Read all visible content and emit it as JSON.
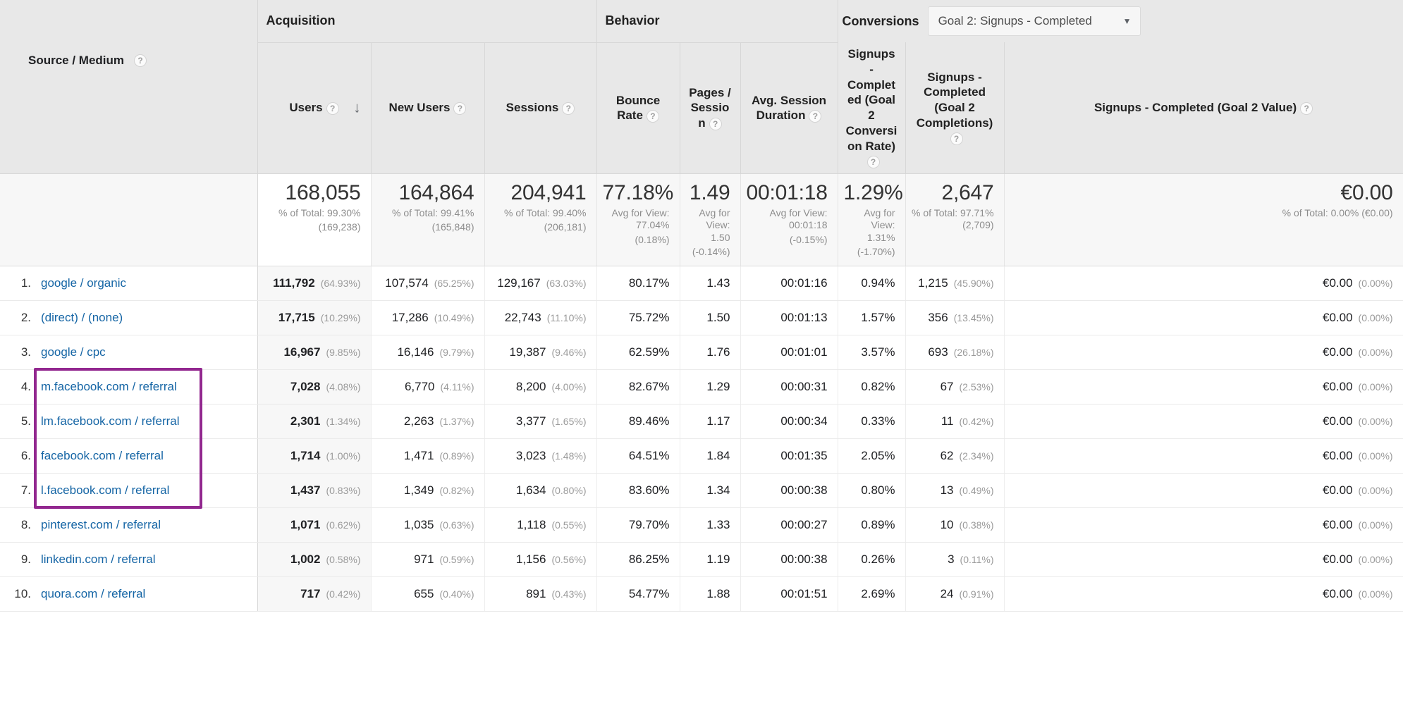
{
  "header": {
    "dimension_label": "Source / Medium",
    "groups": {
      "acquisition": "Acquisition",
      "behavior": "Behavior",
      "conversions": "Conversions"
    },
    "goal_selector": {
      "value": "Goal 2: Signups - Completed",
      "caret": "▼"
    },
    "sort_arrow": "↓",
    "help_icon": "?",
    "columns": [
      {
        "id": "users",
        "label": "Users",
        "has_help": true,
        "sorted": true
      },
      {
        "id": "new_users",
        "label": "New Users",
        "has_help": true,
        "sorted": false
      },
      {
        "id": "sessions",
        "label": "Sessions",
        "has_help": true,
        "sorted": false
      },
      {
        "id": "bounce_rate",
        "label": "Bounce Rate",
        "has_help": true,
        "sorted": false
      },
      {
        "id": "pages_session",
        "label": "Pages / Session",
        "has_help": true,
        "sorted": false
      },
      {
        "id": "avg_session_duration",
        "label": "Avg. Session Duration",
        "has_help": true,
        "sorted": false
      },
      {
        "id": "goal2_rate",
        "label": "Signups - Completed (Goal 2 Conversion Rate)",
        "has_help": true,
        "sorted": false
      },
      {
        "id": "goal2_completions",
        "label": "Signups - Completed (Goal 2 Completions)",
        "has_help": true,
        "sorted": false
      },
      {
        "id": "goal2_value",
        "label": "Signups - Completed (Goal 2 Value)",
        "has_help": true,
        "sorted": false
      }
    ]
  },
  "summary": {
    "users": {
      "value": "168,055",
      "line1": "% of Total: 99.30%",
      "line2": "(169,238)"
    },
    "new_users": {
      "value": "164,864",
      "line1": "% of Total: 99.41%",
      "line2": "(165,848)"
    },
    "sessions": {
      "value": "204,941",
      "line1": "% of Total: 99.40%",
      "line2": "(206,181)"
    },
    "bounce_rate": {
      "value": "77.18%",
      "line1": "Avg for View: 77.04%",
      "line2": "(0.18%)"
    },
    "pages_session": {
      "value": "1.49",
      "line1": "Avg for View: 1.50",
      "line2": "(-0.14%)"
    },
    "avg_session_duration": {
      "value": "00:01:18",
      "line1": "Avg for View: 00:01:18",
      "line2": "(-0.15%)"
    },
    "goal2_rate": {
      "value": "1.29%",
      "line1": "Avg for View: 1.31%",
      "line2": "(-1.70%)"
    },
    "goal2_completions": {
      "value": "2,647",
      "line1": "% of Total: 97.71% (2,709)",
      "line2": ""
    },
    "goal2_value": {
      "value": "€0.00",
      "line1": "% of Total: 0.00% (€0.00)",
      "line2": ""
    }
  },
  "rows": [
    {
      "index": "1.",
      "source": "google / organic",
      "highlighted": false,
      "users": "111,792",
      "users_pct": "(64.93%)",
      "new_users": "107,574",
      "new_users_pct": "(65.25%)",
      "sessions": "129,167",
      "sessions_pct": "(63.03%)",
      "bounce_rate": "80.17%",
      "pages_session": "1.43",
      "avg_session_duration": "00:01:16",
      "goal2_rate": "0.94%",
      "goal2_completions": "1,215",
      "goal2_completions_pct": "(45.90%)",
      "goal2_value": "€0.00",
      "goal2_value_pct": "(0.00%)"
    },
    {
      "index": "2.",
      "source": "(direct) / (none)",
      "highlighted": false,
      "users": "17,715",
      "users_pct": "(10.29%)",
      "new_users": "17,286",
      "new_users_pct": "(10.49%)",
      "sessions": "22,743",
      "sessions_pct": "(11.10%)",
      "bounce_rate": "75.72%",
      "pages_session": "1.50",
      "avg_session_duration": "00:01:13",
      "goal2_rate": "1.57%",
      "goal2_completions": "356",
      "goal2_completions_pct": "(13.45%)",
      "goal2_value": "€0.00",
      "goal2_value_pct": "(0.00%)"
    },
    {
      "index": "3.",
      "source": "google / cpc",
      "highlighted": false,
      "users": "16,967",
      "users_pct": "(9.85%)",
      "new_users": "16,146",
      "new_users_pct": "(9.79%)",
      "sessions": "19,387",
      "sessions_pct": "(9.46%)",
      "bounce_rate": "62.59%",
      "pages_session": "1.76",
      "avg_session_duration": "00:01:01",
      "goal2_rate": "3.57%",
      "goal2_completions": "693",
      "goal2_completions_pct": "(26.18%)",
      "goal2_value": "€0.00",
      "goal2_value_pct": "(0.00%)"
    },
    {
      "index": "4.",
      "source": "m.facebook.com / referral",
      "highlighted": true,
      "users": "7,028",
      "users_pct": "(4.08%)",
      "new_users": "6,770",
      "new_users_pct": "(4.11%)",
      "sessions": "8,200",
      "sessions_pct": "(4.00%)",
      "bounce_rate": "82.67%",
      "pages_session": "1.29",
      "avg_session_duration": "00:00:31",
      "goal2_rate": "0.82%",
      "goal2_completions": "67",
      "goal2_completions_pct": "(2.53%)",
      "goal2_value": "€0.00",
      "goal2_value_pct": "(0.00%)"
    },
    {
      "index": "5.",
      "source": "lm.facebook.com / referral",
      "highlighted": true,
      "users": "2,301",
      "users_pct": "(1.34%)",
      "new_users": "2,263",
      "new_users_pct": "(1.37%)",
      "sessions": "3,377",
      "sessions_pct": "(1.65%)",
      "bounce_rate": "89.46%",
      "pages_session": "1.17",
      "avg_session_duration": "00:00:34",
      "goal2_rate": "0.33%",
      "goal2_completions": "11",
      "goal2_completions_pct": "(0.42%)",
      "goal2_value": "€0.00",
      "goal2_value_pct": "(0.00%)"
    },
    {
      "index": "6.",
      "source": "facebook.com / referral",
      "highlighted": true,
      "users": "1,714",
      "users_pct": "(1.00%)",
      "new_users": "1,471",
      "new_users_pct": "(0.89%)",
      "sessions": "3,023",
      "sessions_pct": "(1.48%)",
      "bounce_rate": "64.51%",
      "pages_session": "1.84",
      "avg_session_duration": "00:01:35",
      "goal2_rate": "2.05%",
      "goal2_completions": "62",
      "goal2_completions_pct": "(2.34%)",
      "goal2_value": "€0.00",
      "goal2_value_pct": "(0.00%)"
    },
    {
      "index": "7.",
      "source": "l.facebook.com / referral",
      "highlighted": true,
      "users": "1,437",
      "users_pct": "(0.83%)",
      "new_users": "1,349",
      "new_users_pct": "(0.82%)",
      "sessions": "1,634",
      "sessions_pct": "(0.80%)",
      "bounce_rate": "83.60%",
      "pages_session": "1.34",
      "avg_session_duration": "00:00:38",
      "goal2_rate": "0.80%",
      "goal2_completions": "13",
      "goal2_completions_pct": "(0.49%)",
      "goal2_value": "€0.00",
      "goal2_value_pct": "(0.00%)"
    },
    {
      "index": "8.",
      "source": "pinterest.com / referral",
      "highlighted": false,
      "users": "1,071",
      "users_pct": "(0.62%)",
      "new_users": "1,035",
      "new_users_pct": "(0.63%)",
      "sessions": "1,118",
      "sessions_pct": "(0.55%)",
      "bounce_rate": "79.70%",
      "pages_session": "1.33",
      "avg_session_duration": "00:00:27",
      "goal2_rate": "0.89%",
      "goal2_completions": "10",
      "goal2_completions_pct": "(0.38%)",
      "goal2_value": "€0.00",
      "goal2_value_pct": "(0.00%)"
    },
    {
      "index": "9.",
      "source": "linkedin.com / referral",
      "highlighted": false,
      "users": "1,002",
      "users_pct": "(0.58%)",
      "new_users": "971",
      "new_users_pct": "(0.59%)",
      "sessions": "1,156",
      "sessions_pct": "(0.56%)",
      "bounce_rate": "86.25%",
      "pages_session": "1.19",
      "avg_session_duration": "00:00:38",
      "goal2_rate": "0.26%",
      "goal2_completions": "3",
      "goal2_completions_pct": "(0.11%)",
      "goal2_value": "€0.00",
      "goal2_value_pct": "(0.00%)"
    },
    {
      "index": "10.",
      "source": "quora.com / referral",
      "highlighted": false,
      "users": "717",
      "users_pct": "(0.42%)",
      "new_users": "655",
      "new_users_pct": "(0.40%)",
      "sessions": "891",
      "sessions_pct": "(0.43%)",
      "bounce_rate": "54.77%",
      "pages_session": "1.88",
      "avg_session_duration": "00:01:51",
      "goal2_rate": "2.69%",
      "goal2_completions": "24",
      "goal2_completions_pct": "(0.91%)",
      "goal2_value": "€0.00",
      "goal2_value_pct": "(0.00%)"
    }
  ],
  "annotation": {
    "highlight_color": "#92278f"
  }
}
